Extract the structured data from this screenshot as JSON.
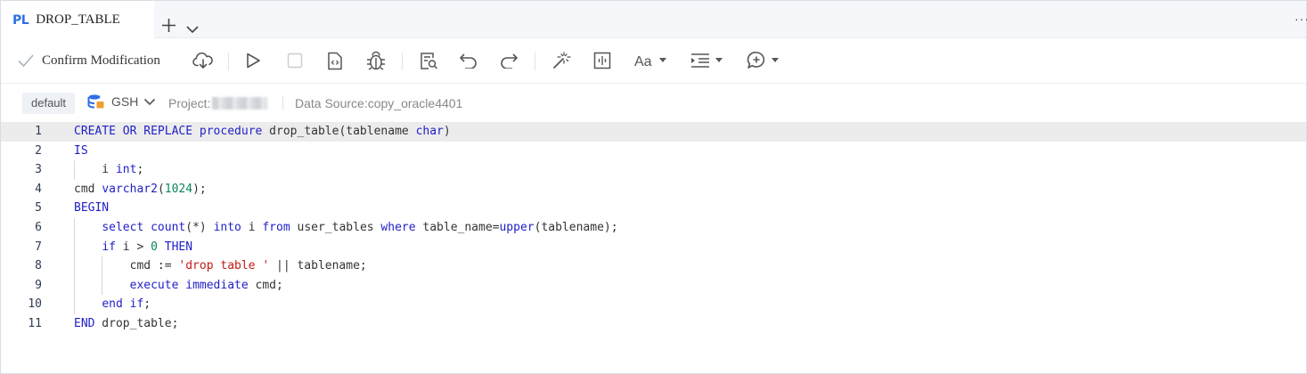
{
  "tab": {
    "badge": "PL",
    "title": "DROP_TABLE"
  },
  "toolbar": {
    "confirm_label": "Confirm Modification",
    "buttons": [
      "upload-cloud-icon",
      "run-icon",
      "stop-icon",
      "format-file-icon",
      "debug-icon",
      "find-icon",
      "undo-icon",
      "redo-icon",
      "magic-wand-icon",
      "split-view-icon",
      "font-size-icon",
      "indent-icon",
      "comment-icon"
    ],
    "font_label": "Aa"
  },
  "info": {
    "env": "default",
    "schema": "GSH",
    "project_label": "Project:",
    "datasource": "Data Source:copy_oracle4401"
  },
  "editor": {
    "active_line": 1,
    "lines": [
      {
        "n": "1"
      },
      {
        "n": "2"
      },
      {
        "n": "3"
      },
      {
        "n": "4"
      },
      {
        "n": "5"
      },
      {
        "n": "6"
      },
      {
        "n": "7"
      },
      {
        "n": "8"
      },
      {
        "n": "9"
      },
      {
        "n": "10"
      },
      {
        "n": "11"
      }
    ],
    "code": [
      "CREATE OR REPLACE procedure drop_table(tablename char)",
      "IS",
      "    i int;",
      "cmd varchar2(1024);",
      "BEGIN",
      "    select count(*) into i from user_tables where table_name=upper(tablename);",
      "    if i > 0 THEN",
      "        cmd := 'drop table ' || tablename;",
      "        execute immediate cmd;",
      "    end if;",
      "END drop_table;"
    ]
  },
  "colors": {
    "keyword": "#1f1fc7",
    "number": "#098658",
    "string": "#c41a16",
    "accent": "#2d6fe8"
  }
}
